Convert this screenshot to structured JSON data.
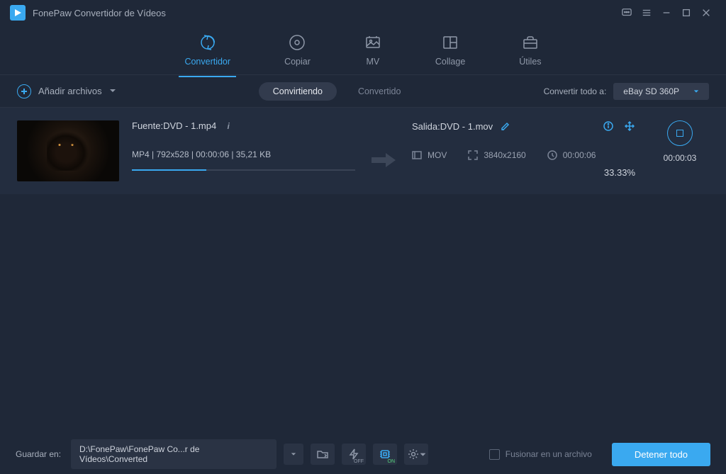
{
  "titlebar": {
    "title": "FonePaw Convertidor de Vídeos"
  },
  "nav": {
    "convertidor": "Convertidor",
    "copiar": "Copiar",
    "mv": "MV",
    "collage": "Collage",
    "utiles": "Útiles"
  },
  "subbar": {
    "add_files": "Añadir archivos",
    "converting": "Convirtiendo",
    "converted": "Convertido",
    "convert_all_label": "Convertir todo a:",
    "preset": "eBay SD 360P"
  },
  "item": {
    "source_label": "Fuente:DVD - 1.mp4",
    "meta_line": "MP4 | 792x528 | 00:00:06 | 35,21 KB",
    "output_label": "Salida:DVD - 1.mov",
    "out_format": "MOV",
    "out_resolution": "3840x2160",
    "out_duration": "00:00:06",
    "percent": "33.33%",
    "progress_pct": 33.33,
    "elapsed": "00:00:03"
  },
  "bottom": {
    "save_in": "Guardar en:",
    "path": "D:\\FonePaw\\FonePaw Co...r de Vídeos\\Converted",
    "flash_sub": "OFF",
    "gpu_sub": "ON",
    "merge_label": "Fusionar en un archivo",
    "main_action": "Detener todo"
  }
}
